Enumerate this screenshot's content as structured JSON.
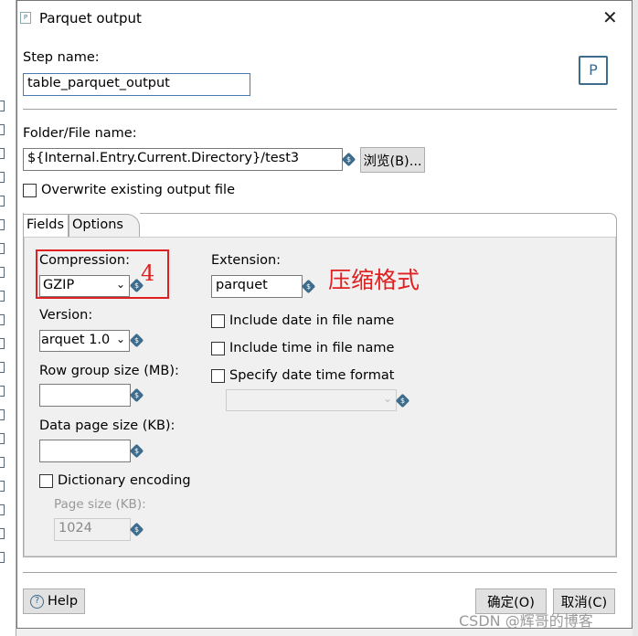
{
  "window": {
    "title": "Parquet output",
    "close_icon": "close-icon",
    "step_icon": "parquet-step-icon"
  },
  "step_name": {
    "label": "Step name:",
    "value": "table_parquet_output"
  },
  "folder": {
    "label": "Folder/File name:",
    "value": "${Internal.Entry.Current.Directory}/test3",
    "browse_label": "浏览(B)..."
  },
  "overwrite": {
    "label": "Overwrite existing output file",
    "checked": false
  },
  "tabs": [
    {
      "label": "Fields"
    },
    {
      "label": "Options",
      "active": true
    }
  ],
  "options": {
    "compression": {
      "label": "Compression:",
      "value": "GZIP"
    },
    "annotation_number": "4",
    "annotation_text": "压缩格式",
    "annotation_color": "#e02020",
    "version": {
      "label": "Version:",
      "value": "arquet 1.0"
    },
    "row_group": {
      "label": "Row group size (MB):",
      "value": ""
    },
    "data_page": {
      "label": "Data page size (KB):",
      "value": ""
    },
    "dictionary": {
      "label": "Dictionary encoding",
      "checked": false
    },
    "page_size": {
      "label": "Page size (KB):",
      "value": "1024"
    },
    "extension": {
      "label": "Extension:",
      "value": "parquet"
    },
    "include_date": {
      "label": "Include date in file name",
      "checked": false
    },
    "include_time": {
      "label": "Include time in file name",
      "checked": false
    },
    "specify_format": {
      "label": "Specify date time format",
      "checked": false,
      "value": ""
    }
  },
  "footer": {
    "help": "Help",
    "ok": "确定(O)",
    "cancel": "取消(C)"
  },
  "watermark": "CSDN @辉哥的博客"
}
